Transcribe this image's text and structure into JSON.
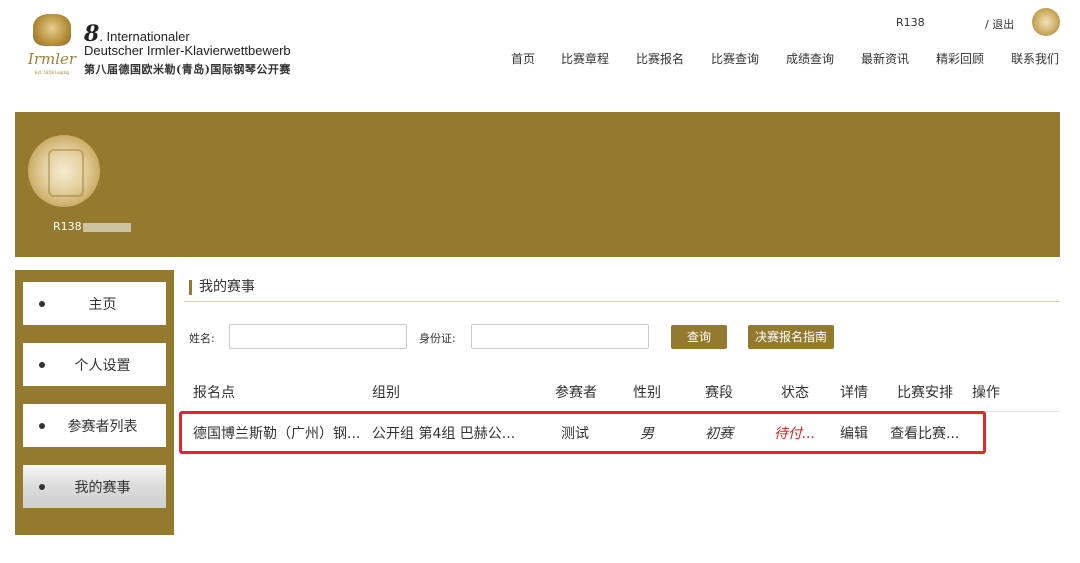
{
  "logo": {
    "number": "8",
    "line1": ". Internationaler",
    "line2": "Deutscher Irmler-Klavierwettbewerb",
    "line3": "第八届德国欧米勒(青岛)国际钢琴公开赛",
    "script": "Irmler",
    "tiny": "Est. 1818 Leipzig"
  },
  "top_user": {
    "username": "R138",
    "logout": "/ 退出"
  },
  "nav": [
    "首页",
    "比赛章程",
    "比赛报名",
    "比赛查询",
    "成绩查询",
    "最新资讯",
    "精彩回顾",
    "联系我们"
  ],
  "banner": {
    "username": "R138"
  },
  "sidebar": {
    "items": [
      {
        "label": "主页"
      },
      {
        "label": "个人设置"
      },
      {
        "label": "参赛者列表"
      },
      {
        "label": "我的赛事"
      }
    ]
  },
  "main": {
    "title": "我的赛事",
    "search": {
      "name_label": "姓名:",
      "name_value": "",
      "id_label": "身份证:",
      "id_value": "",
      "query_button": "查询",
      "guide_button": "决赛报名指南"
    },
    "table": {
      "headers": [
        "报名点",
        "组别",
        "参赛者",
        "性别",
        "赛段",
        "状态",
        "详情",
        "比赛安排",
        "操作"
      ],
      "rows": [
        {
          "site": "德国博兰斯勒（广州）钢...",
          "group": "公开组 第4组 巴赫公...",
          "participant": "测试",
          "gender": "男",
          "stage": "初赛",
          "status": "待付...",
          "details": "编辑",
          "schedule": "查看比赛...",
          "action": ""
        }
      ]
    }
  },
  "colors": {
    "accent": "#937a2e",
    "status_red": "#e02020",
    "highlight_box": "#e8261f"
  }
}
